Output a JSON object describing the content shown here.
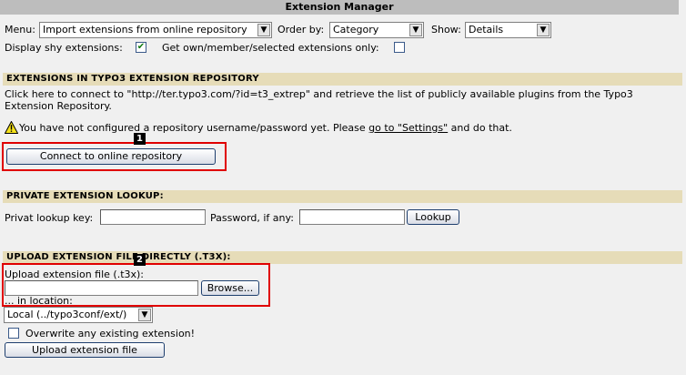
{
  "window_title": "Extension Manager",
  "controls": {
    "menu_label": "Menu:",
    "menu_value": "Import extensions from online repository",
    "order_label": "Order by:",
    "order_value": "Category",
    "show_label": "Show:",
    "show_value": "Details",
    "display_shy_label": "Display shy extensions:",
    "display_shy_checked": true,
    "get_own_label": "Get own/member/selected extensions only:",
    "get_own_checked": false
  },
  "repository": {
    "heading": "EXTENSIONS IN TYPO3 EXTENSION REPOSITORY",
    "description_line1": "Click here to connect to \"http://ter.typo3.com/?id=t3_extrep\" and retrieve the list of publicly available plugins from the Typo3",
    "description_line2": "Extension Repository.",
    "warning_prefix": "You have not configured a repository username/password yet. Please",
    "warning_link": "go to \"Settings\"",
    "warning_suffix": "and do that.",
    "connect_button": "Connect to online repository",
    "marker": "1"
  },
  "private_lookup": {
    "heading": "PRIVATE EXTENSION LOOKUP:",
    "key_label": "Privat lookup key:",
    "password_label": "Password, if any:",
    "lookup_button": "Lookup"
  },
  "upload": {
    "heading": "UPLOAD EXTENSION FILE DIRECTLY (.T3X):",
    "file_label": "Upload extension file (.t3x):",
    "browse_button": "Browse...",
    "marker": "2",
    "location_label": "... in location:",
    "location_value": "Local (../typo3conf/ext/)",
    "overwrite_label": "Overwrite any existing extension!",
    "upload_button": "Upload extension file"
  },
  "colors": {
    "section_bg": "#e6dcb8",
    "title_bg": "#bdbdbd",
    "highlight": "#e00000"
  }
}
